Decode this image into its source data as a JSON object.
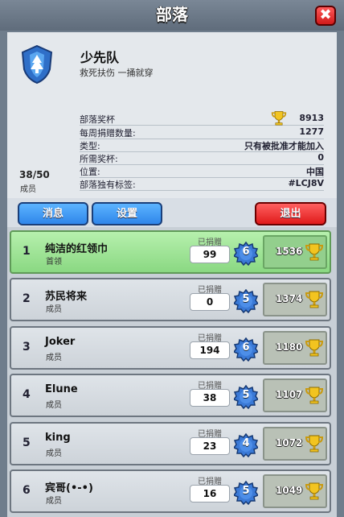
{
  "header": {
    "title": "部落",
    "close_label": "✖"
  },
  "clan": {
    "name": "少先队",
    "description": "救死扶伤 一捅就穿",
    "members_count": "38/50",
    "members_label": "成员",
    "badge_icon": "tree-shield-icon",
    "stats": [
      {
        "key": "部落奖杯",
        "value": "8913",
        "icon": "trophy-icon"
      },
      {
        "key": "每周捐赠数量:",
        "value": "1277"
      },
      {
        "key": "类型:",
        "value": "只有被批准才能加入"
      },
      {
        "key": "所需奖杯:",
        "value": "0"
      },
      {
        "key": "位置:",
        "value": "中国"
      },
      {
        "key": "部落独有标签:",
        "value": "#LCJ8V"
      }
    ]
  },
  "buttons": {
    "messages": "消息",
    "settings": "设置",
    "leave": "退出"
  },
  "members": [
    {
      "rank": "1",
      "name": "纯洁的红领巾",
      "role": "首领",
      "donated_label": "已捐赠",
      "donated": "99",
      "level": "6",
      "trophies": "1536",
      "highlight": true
    },
    {
      "rank": "2",
      "name": "苏民将来",
      "role": "成员",
      "donated_label": "已捐赠",
      "donated": "0",
      "level": "5",
      "trophies": "1374"
    },
    {
      "rank": "3",
      "name": "Joker",
      "role": "成员",
      "donated_label": "已捐赠",
      "donated": "194",
      "level": "6",
      "trophies": "1180"
    },
    {
      "rank": "4",
      "name": "Elune",
      "role": "成员",
      "donated_label": "已捐赠",
      "donated": "38",
      "level": "5",
      "trophies": "1107"
    },
    {
      "rank": "5",
      "name": "king",
      "role": "成员",
      "donated_label": "已捐赠",
      "donated": "23",
      "level": "4",
      "trophies": "1072"
    },
    {
      "rank": "6",
      "name": "宾哥(•-•)",
      "role": "成员",
      "donated_label": "已捐赠",
      "donated": "16",
      "level": "5",
      "trophies": "1049"
    }
  ],
  "colors": {
    "accent_blue": "#2f86ea",
    "leave_red": "#e01a1a",
    "highlight_green": "#8ad882",
    "level_blue": "#3a79d6"
  }
}
